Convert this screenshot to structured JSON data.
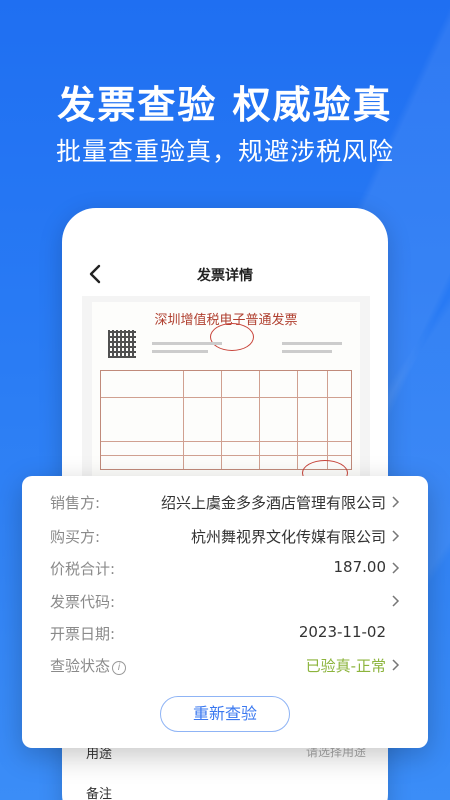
{
  "promo": {
    "headline": "发票查验 权威验真",
    "subline": "批量查重验真，规避涉税风险"
  },
  "screen": {
    "title": "发票详情",
    "back_icon": "chevron-left-icon"
  },
  "invoice_image": {
    "title": "深圳增值税电子普通发票"
  },
  "details": {
    "rows": [
      {
        "label": "销售方:",
        "value": "绍兴上虞金多多酒店管理有限公司"
      },
      {
        "label": "购买方:",
        "value": "杭州舞视界文化传媒有限公司"
      },
      {
        "label": "价税合计:",
        "value": "187.00"
      },
      {
        "label": "发票代码:",
        "value": ""
      },
      {
        "label": "开票日期:",
        "value": "2023-11-02"
      },
      {
        "label": "查验状态",
        "value": "已验真-正常"
      }
    ],
    "status_color": "#8cb43c",
    "requery_label": "重新查验"
  },
  "below": {
    "usage_label": "用途",
    "usage_placeholder": "请选择用途",
    "remark_label": "备注"
  },
  "colors": {
    "bg_blue": "#2a7cf4",
    "button_text": "#3a78f0"
  }
}
